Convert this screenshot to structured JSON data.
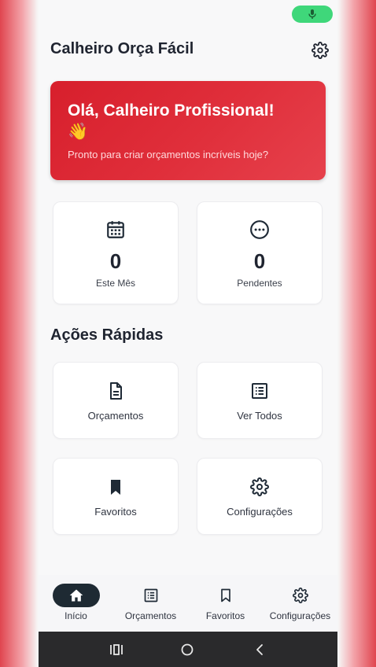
{
  "app": {
    "title": "Calheiro Orça Fácil"
  },
  "colors": {
    "brand_red": "#d71f2c",
    "nav_active": "#1e2a33",
    "mic_green": "#3fd77a"
  },
  "welcome": {
    "title": "Olá, Calheiro Profissional!",
    "emoji": "👋",
    "subtitle": "Pronto para criar orçamentos incríveis hoje?"
  },
  "stats": [
    {
      "icon": "calendar-icon",
      "value": "0",
      "label": "Este Mês"
    },
    {
      "icon": "more-circle-icon",
      "value": "0",
      "label": "Pendentes"
    }
  ],
  "quick_actions": {
    "title": "Ações Rápidas",
    "items": [
      {
        "icon": "document-icon",
        "label": "Orçamentos"
      },
      {
        "icon": "list-icon",
        "label": "Ver Todos"
      },
      {
        "icon": "bookmark-icon",
        "label": "Favoritos"
      },
      {
        "icon": "gear-icon",
        "label": "Configurações"
      }
    ]
  },
  "bottom_nav": {
    "items": [
      {
        "icon": "home-icon",
        "label": "Início",
        "active": true
      },
      {
        "icon": "list-icon",
        "label": "Orçamentos",
        "active": false
      },
      {
        "icon": "bookmark-outline-icon",
        "label": "Favoritos",
        "active": false
      },
      {
        "icon": "gear-icon",
        "label": "Configurações",
        "active": false
      }
    ]
  },
  "system_nav": {
    "items": [
      "recents-icon",
      "home-circle-icon",
      "back-icon"
    ]
  }
}
